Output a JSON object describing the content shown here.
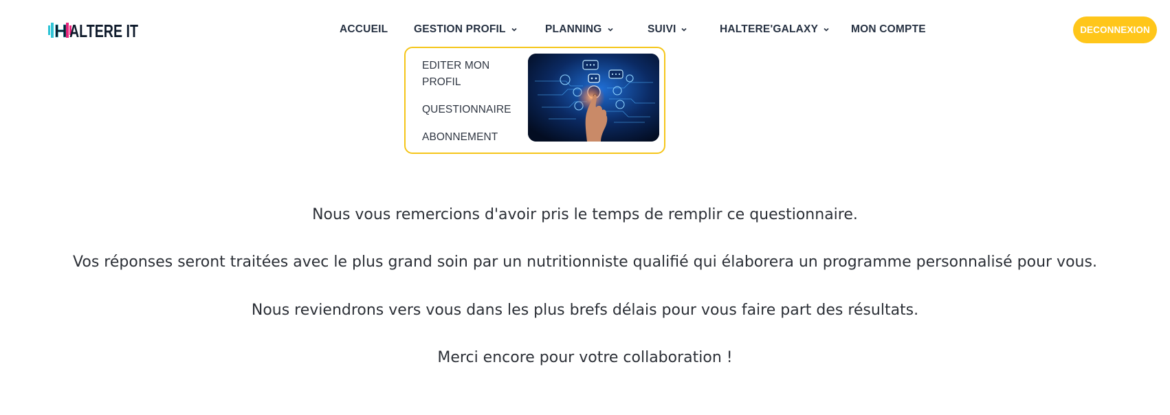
{
  "brand": {
    "logo_text": "HALTERE IT",
    "accent_colors": [
      "#2ec4d6",
      "#e8247c",
      "#0e1a2b"
    ]
  },
  "nav": {
    "items": [
      {
        "label": "ACCUEIL",
        "has_dropdown": false
      },
      {
        "label": "GESTION PROFIL",
        "has_dropdown": true
      },
      {
        "label": "PLANNING",
        "has_dropdown": true
      },
      {
        "label": "SUIVI",
        "has_dropdown": true
      },
      {
        "label": "HALTERE'GALAXY",
        "has_dropdown": true
      },
      {
        "label": "MON COMPTE",
        "has_dropdown": false
      }
    ],
    "logout_label": "DECONNEXION",
    "logout_color": "#ffc61a"
  },
  "dropdown": {
    "border_color": "#f5c518",
    "items": [
      {
        "label": "EDITER MON PROFIL"
      },
      {
        "label": "QUESTIONNAIRE"
      },
      {
        "label": "ABONNEMENT"
      }
    ],
    "image_icon": "ai-hand-tech-illustration"
  },
  "content": {
    "paragraphs": [
      "Nous vous remercions d'avoir pris le temps de remplir ce questionnaire.",
      "Vos réponses seront traitées avec le plus grand soin par un nutritionniste qualifié qui élaborera un programme personnalisé pour vous.",
      "Nous reviendrons vers vous dans les plus brefs délais pour vous faire part des résultats.",
      "Merci encore pour votre collaboration !"
    ]
  }
}
